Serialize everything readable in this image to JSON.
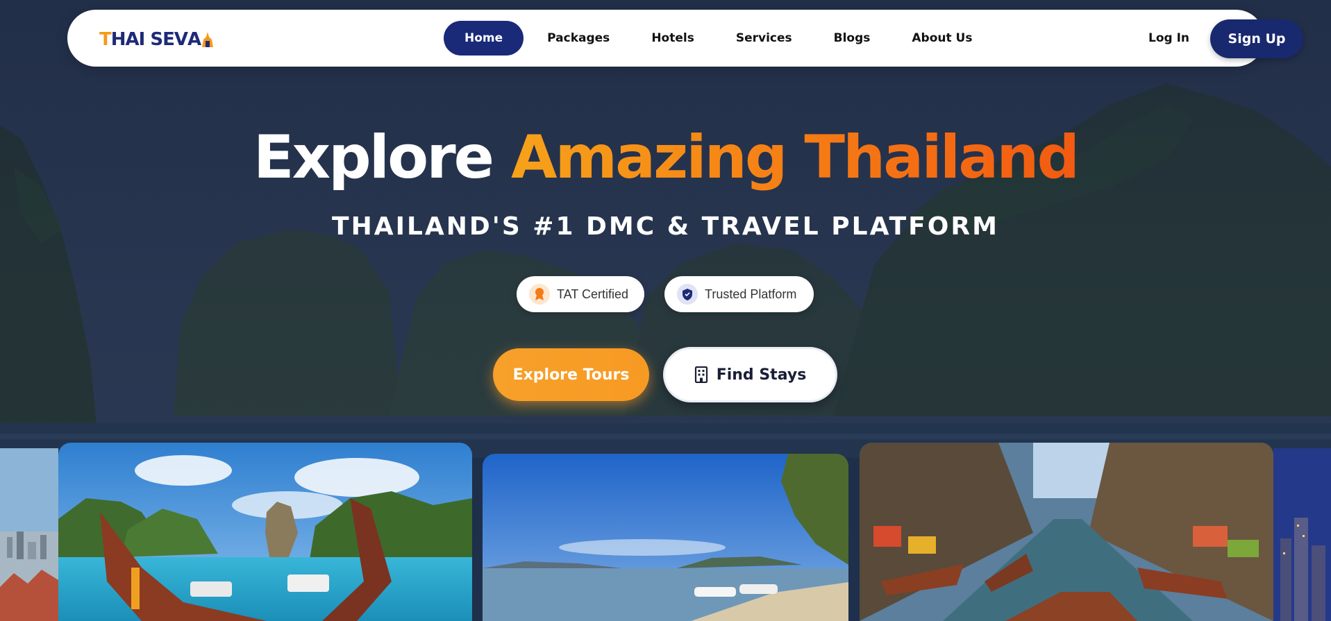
{
  "brand": {
    "logo_text_first": "T",
    "logo_text_rest": "HAI SEV",
    "logo_text_last": "A"
  },
  "nav": {
    "items": [
      {
        "label": "Home",
        "active": true
      },
      {
        "label": "Packages",
        "active": false
      },
      {
        "label": "Hotels",
        "active": false
      },
      {
        "label": "Services",
        "active": false
      },
      {
        "label": "Blogs",
        "active": false
      },
      {
        "label": "About Us",
        "active": false
      }
    ],
    "login_label": "Log In",
    "signup_label": "Sign Up"
  },
  "hero": {
    "title_white": "Explore",
    "title_accent": "Amazing Thailand",
    "subtitle": "THAILAND'S #1 DMC & TRAVEL PLATFORM",
    "badges": [
      {
        "label": "TAT Certified",
        "icon": "award-icon"
      },
      {
        "label": "Trusted Platform",
        "icon": "shield-icon"
      }
    ],
    "primary_cta": "Explore Tours",
    "secondary_cta": "Find Stays"
  },
  "cards": [
    {
      "scene": "city-skyline-edge"
    },
    {
      "scene": "longtail-boats-limestone-islands"
    },
    {
      "scene": "beach-speedboats"
    },
    {
      "scene": "floating-market"
    },
    {
      "scene": "city-night-edge"
    }
  ],
  "colors": {
    "brand_navy": "#1a2a78",
    "accent_orange": "#f79a23",
    "accent_red_orange": "#f25a12"
  }
}
